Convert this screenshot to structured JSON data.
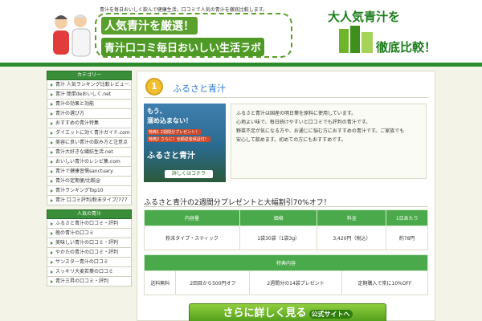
{
  "header": {
    "description": "青汁を毎日おいしく飲んで健康生活。口コミで人気の青汁を徹底比較します。",
    "line1": "人気青汁を厳選！",
    "line2": "青汁口コミ毎日おいしい生活ラボ",
    "compare_line1": "大人気青汁を",
    "compare_line2": "徹底比較！"
  },
  "sidebar": {
    "section1_title": "カテゴリー",
    "section1_items": [
      "青汁 人気ランキング比較レビュー.com",
      "青汁 簡単deおいしく.net",
      "青汁の効果と効能",
      "青汁の選び方",
      "おすすめの青汁特集",
      "ダイエットに効く青汁ガイド.com",
      "美容に良い青汁の飲み方と注意点",
      "青汁大好きな繊紡生活.net",
      "おいしい青汁のレシピ集.com",
      "青汁で健康習慣sanctuary",
      "青汁の定期便/比較@",
      "青汁ランキングTop10",
      "青汁 口コミ評判/粉末タイプ/777"
    ],
    "section2_title": "人気の青汁",
    "section2_items": [
      "ふるさと青汁の口コミ・評判",
      "極の青汁の口コミ",
      "美味しい青汁の口コミ・評判",
      "やかたの青汁の口コミ・評判",
      "サンスター青汁の口コミ",
      "スッキリ大麦若葉の口コミ",
      "青汁三昇の口コミ・評判"
    ]
  },
  "main": {
    "rank": "1",
    "product_name": "ふるさと青汁",
    "ad": {
      "line1": "もう、",
      "line2": "溜め込まない！",
      "tag1": "特典1 2週間分プレゼント！",
      "tag2": "特典2 さらに！全額返金保証付！",
      "brand": "ふるさと青汁",
      "cta": "詳しくはコチラ"
    },
    "description_lines": [
      "ふるさと青汁は国産の明日葉を原料に使用しています。",
      "心地よい味で、毎日続けやすいと口コミでも評判の青汁です。",
      "野菜不足が気になる方や、お通じに悩む方におすすめの青汁です。ご家族でも",
      "安心して飲めます。初めての方にもおすすめです。"
    ],
    "section_title": "ふるさと青汁の2週間分プレゼントと大幅割引70%オフ！",
    "spec_headers": [
      "内容量",
      "価格",
      "料金",
      "1日あたり"
    ],
    "spec_values": [
      "粉末タイプ・スティック",
      "1袋30袋（1袋3g）",
      "3,420円（税込）",
      "約78円"
    ],
    "bonus_header": "特典内容",
    "bonus_values": [
      "送料無料",
      "2回目から500円オフ",
      "2週間分の14袋プレゼント",
      "定期購入で常に10%OFF"
    ],
    "cta_label": "さらに詳しく見る",
    "cta_sub": "公式サイトへ"
  }
}
